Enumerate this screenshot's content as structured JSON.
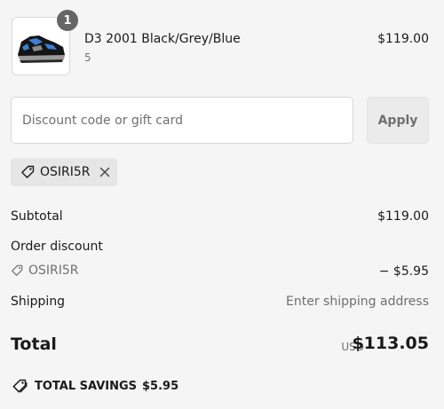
{
  "cart": {
    "item": {
      "quantity": "1",
      "name": "D3 2001 Black/Grey/Blue",
      "variant": "5",
      "price": "$119.00"
    }
  },
  "discount": {
    "placeholder": "Discount code or gift card",
    "value": "",
    "apply_label": "Apply",
    "applied_code": "OSIRI5R"
  },
  "summary": {
    "subtotal_label": "Subtotal",
    "subtotal_value": "$119.00",
    "order_discount_label": "Order discount",
    "discount_code": "OSIRI5R",
    "discount_value": "− $5.95",
    "shipping_label": "Shipping",
    "shipping_value": "Enter shipping address",
    "total_label": "Total",
    "currency": "USD",
    "total_value": "$113.05",
    "savings_label": "TOTAL SAVINGS",
    "savings_value": "$5.95"
  },
  "icons": {
    "product_image": "sneaker-image",
    "tag": "tag-icon",
    "remove": "close-icon"
  },
  "colors": {
    "page_bg": "#f5f5f5",
    "text": "#1a1a1a",
    "muted": "#707070",
    "badge_bg": "#666666"
  }
}
